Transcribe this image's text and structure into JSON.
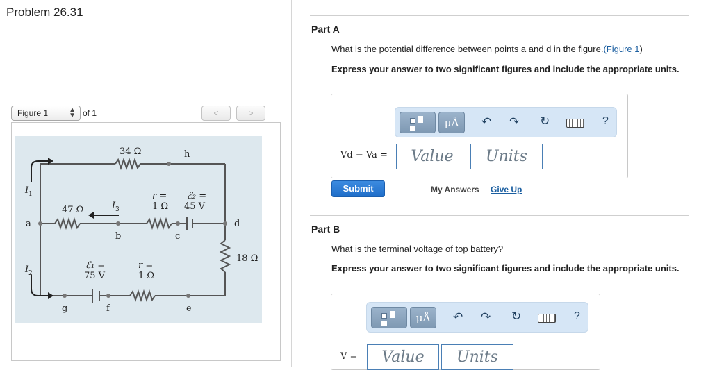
{
  "problem_title": "Problem 26.31",
  "figure": {
    "select_label": "Figure 1",
    "of_label": "of 1",
    "prev_glyph": "<",
    "next_glyph": ">",
    "labels": {
      "r34": "34 Ω",
      "h": "h",
      "I1": "I",
      "I1sub": "1",
      "r47": "47 Ω",
      "I3": "I",
      "I3sub": "3",
      "rtop1": "r =",
      "rtop2": "1 Ω",
      "e2a": "ℰ₂ =",
      "e2b": "45 V",
      "a": "a",
      "b": "b",
      "c": "c",
      "d": "d",
      "r18": "18 Ω",
      "I2": "I",
      "I2sub": "2",
      "e1a": "ℰ₁ =",
      "e1b": "75 V",
      "rbot1": "r =",
      "rbot2": "1 Ω",
      "g": "g",
      "f": "f",
      "e": "e"
    }
  },
  "partA": {
    "heading": "Part A",
    "question": "What is the potential difference between points a and d in the figure.",
    "figure_link": "(Figure 1",
    "question_end": ")",
    "instruction": "Express your answer to two significant figures and include the appropriate units.",
    "var_label": "Vd − Va =",
    "value_placeholder": "Value",
    "units_placeholder": "Units",
    "unit_button": "μÅ",
    "help": "?"
  },
  "submit_label": "Submit",
  "my_answers": "My Answers",
  "give_up": "Give Up",
  "partB": {
    "heading": "Part B",
    "question": "What is the terminal voltage of top battery?",
    "instruction": "Express your answer to two significant figures and include the appropriate units.",
    "var_label": "V =",
    "value_placeholder": "Value",
    "units_placeholder": "Units",
    "unit_button": "μÅ",
    "help": "?"
  },
  "icons": [
    "template-icon",
    "units-icon",
    "undo-icon",
    "redo-icon",
    "reset-icon",
    "keyboard-icon",
    "help-icon"
  ]
}
